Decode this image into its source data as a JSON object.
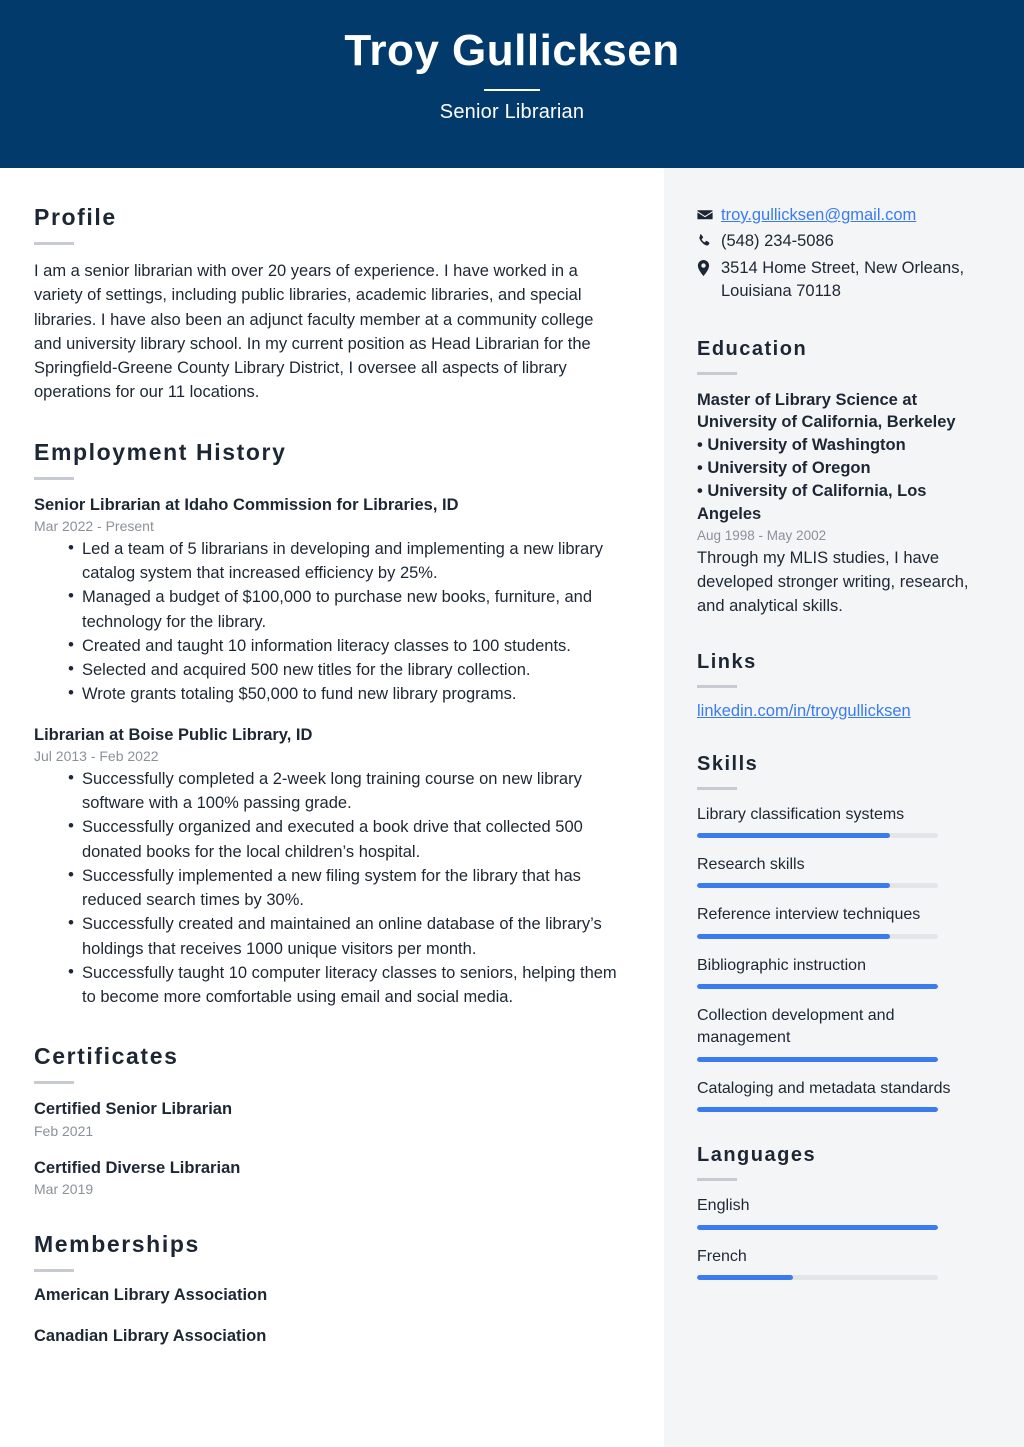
{
  "header": {
    "name": "Troy Gullicksen",
    "job_title": "Senior Librarian",
    "background_color": "#023a6b"
  },
  "accent_color": "#3a7bf0",
  "main": {
    "profile": {
      "heading": "Profile",
      "text": "I am a senior librarian with over 20 years of experience. I have worked in a variety of settings, including public libraries, academic libraries, and special libraries. I have also been an adjunct faculty member at a community college and university library school. In my current position as Head Librarian for the Springfield-Greene County Library District, I oversee all aspects of library operations for our 11 locations."
    },
    "employment": {
      "heading": "Employment History",
      "jobs": [
        {
          "title": "Senior Librarian at Idaho Commission for Libraries, ID",
          "date": "Mar 2022 - Present",
          "bullets": [
            "Led a team of 5 librarians in developing and implementing a new library catalog system that increased efficiency by 25%.",
            "Managed a budget of $100,000 to purchase new books, furniture, and technology for the library.",
            "Created and taught 10 information literacy classes to 100 students.",
            "Selected and acquired 500 new titles for the library collection.",
            "Wrote grants totaling $50,000 to fund new library programs."
          ]
        },
        {
          "title": "Librarian at Boise Public Library, ID",
          "date": "Jul 2013 - Feb 2022",
          "bullets": [
            "Successfully completed a 2-week long training course on new library software with a 100% passing grade.",
            "Successfully organized and executed a book drive that collected 500 donated books for the local children’s hospital.",
            "Successfully implemented a new filing system for the library that has reduced search times by 30%.",
            "Successfully created and maintained an online database of the library’s holdings that receives 1000 unique visitors per month.",
            "Successfully taught 10 computer literacy classes to seniors, helping them to become more comfortable using email and social media."
          ]
        }
      ]
    },
    "certificates": {
      "heading": "Certificates",
      "items": [
        {
          "title": "Certified Senior Librarian",
          "date": "Feb 2021"
        },
        {
          "title": "Certified Diverse Librarian",
          "date": "Mar 2019"
        }
      ]
    },
    "memberships": {
      "heading": "Memberships",
      "items": [
        "American Library Association",
        "Canadian Library Association"
      ]
    }
  },
  "sidebar": {
    "contact": [
      {
        "icon": "envelope-icon",
        "value": "troy.gullicksen@gmail.com",
        "is_link": true
      },
      {
        "icon": "phone-icon",
        "value": "(548) 234-5086",
        "is_link": false
      },
      {
        "icon": "location-pin-icon",
        "value": "3514 Home Street, New Orleans, Louisiana 70118",
        "is_link": false
      }
    ],
    "education": {
      "heading": "Education",
      "title": "Master of Library Science at University of California, Berkeley\n• University of Washington\n• University of Oregon\n• University of California, Los Angeles",
      "date": "Aug 1998 - May 2002",
      "description": "Through my MLIS studies, I have developed stronger writing, research, and analytical skills."
    },
    "links": {
      "heading": "Links",
      "items": [
        {
          "label": "linkedin.com/in/troygullicksen"
        }
      ]
    },
    "skills": {
      "heading": "Skills",
      "items": [
        {
          "label": "Library classification systems",
          "level": 80
        },
        {
          "label": "Research skills",
          "level": 80
        },
        {
          "label": "Reference interview techniques",
          "level": 80
        },
        {
          "label": "Bibliographic instruction",
          "level": 100
        },
        {
          "label": "Collection development and management",
          "level": 100
        },
        {
          "label": "Cataloging and metadata standards",
          "level": 100
        }
      ]
    },
    "languages": {
      "heading": "Languages",
      "items": [
        {
          "label": "English",
          "level": 100
        },
        {
          "label": "French",
          "level": 40
        }
      ]
    }
  }
}
